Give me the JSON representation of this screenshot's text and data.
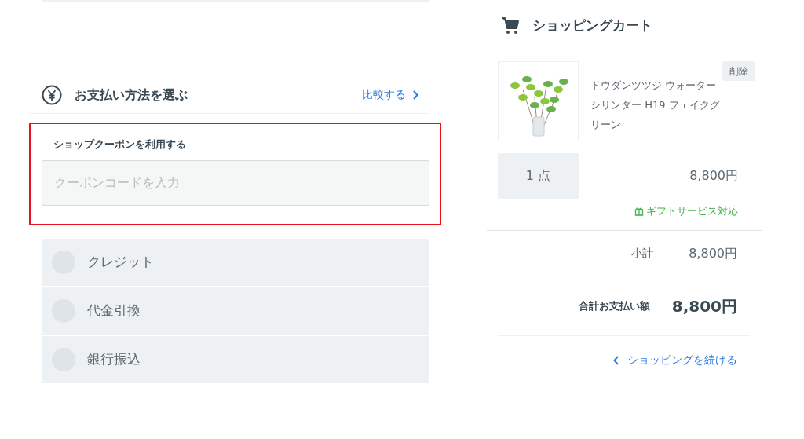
{
  "payment": {
    "title": "お支払い方法を選ぶ",
    "compare_link": "比較する"
  },
  "coupon": {
    "label": "ショップクーポンを利用する",
    "placeholder": "クーポンコードを入力"
  },
  "payment_options": [
    {
      "label": "クレジット",
      "selected": false
    },
    {
      "label": "代金引換",
      "selected": false
    },
    {
      "label": "銀行振込",
      "selected": false
    }
  ],
  "cart": {
    "title": "ショッピングカート",
    "item": {
      "name": "ドウダンツツジ ウォーターシリンダー H19 フェイクグリーン",
      "delete": "削除",
      "quantity": "1 点",
      "price": "8,800円",
      "gift": "ギフトサービス対応"
    },
    "subtotal_label": "小計",
    "subtotal": "8,800円",
    "total_label": "合計お支払い額",
    "total": "8,800円",
    "continue_link": "ショッピングを続ける"
  }
}
